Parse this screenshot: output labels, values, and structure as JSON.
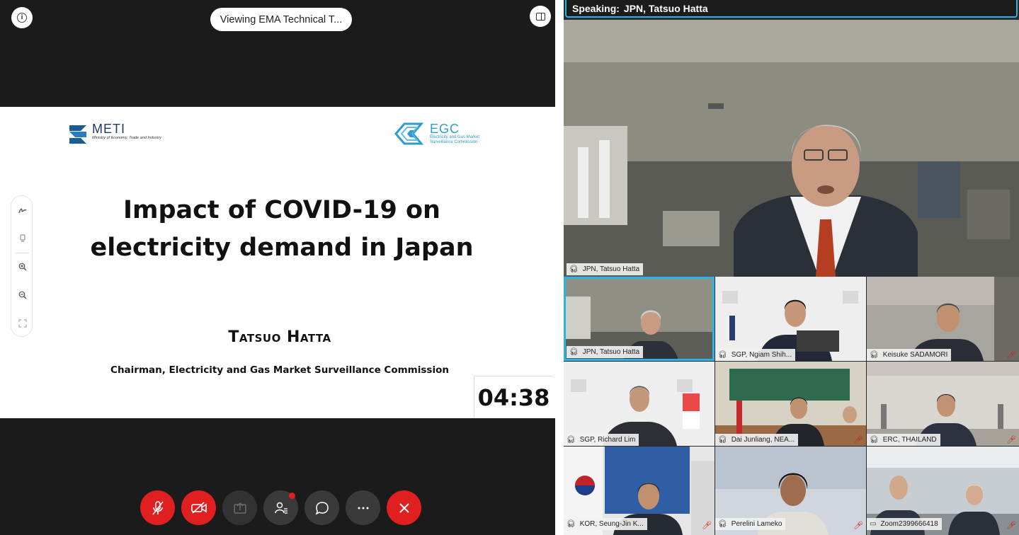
{
  "window": {
    "viewing_label": "Viewing EMA Technical T..."
  },
  "slide": {
    "meti_name": "METI",
    "meti_subtitle": "Ministry of Economy, Trade and Industry",
    "egc_name": "EGC",
    "egc_subtitle": "Electricity and Gas Market Surveillance Commission",
    "title_line1": "Impact of COVID-19 on",
    "title_line2": "electricity demand in Japan",
    "author": "Tatsuo Hatta",
    "role": "Chairman, Electricity and Gas Market Surveillance Commission"
  },
  "timer": "04:38",
  "speaking": {
    "label": "Speaking:",
    "name": "JPN, Tatsuo Hatta"
  },
  "main_video": {
    "name": "JPN, Tatsuo Hatta"
  },
  "participants": [
    {
      "name": "JPN, Tatsuo Hatta",
      "muted": false,
      "active": true
    },
    {
      "name": "SGP, Ngiam Shih...",
      "muted": false,
      "active": false
    },
    {
      "name": "Keisuke SADAMORI",
      "muted": true,
      "active": false
    },
    {
      "name": "SGP, Richard Lim",
      "muted": false,
      "active": false
    },
    {
      "name": "Dai Junliang, NEA...",
      "muted": true,
      "active": false
    },
    {
      "name": "ERC, THAILAND",
      "muted": true,
      "active": false
    },
    {
      "name": "KOR, Seung-Jin K...",
      "muted": true,
      "active": false
    },
    {
      "name": "Perelini Lameko",
      "muted": true,
      "active": false
    },
    {
      "name": "Zoom2399666418",
      "muted": true,
      "active": false
    }
  ],
  "icons": {
    "info": "info-icon",
    "panel": "panel-layout-icon",
    "annotate": [
      "pen-icon",
      "eraser-icon",
      "zoom-in-icon",
      "zoom-out-icon",
      "fit-screen-icon"
    ],
    "controls": [
      "mic-muted-icon",
      "video-off-icon",
      "share-icon",
      "participants-icon",
      "chat-icon",
      "more-icon",
      "end-call-icon"
    ]
  },
  "colors": {
    "accent": "#2ab3e6",
    "danger": "#e02020",
    "meti_blue": "#1a5d95",
    "egc_blue": "#2f9bcc"
  }
}
